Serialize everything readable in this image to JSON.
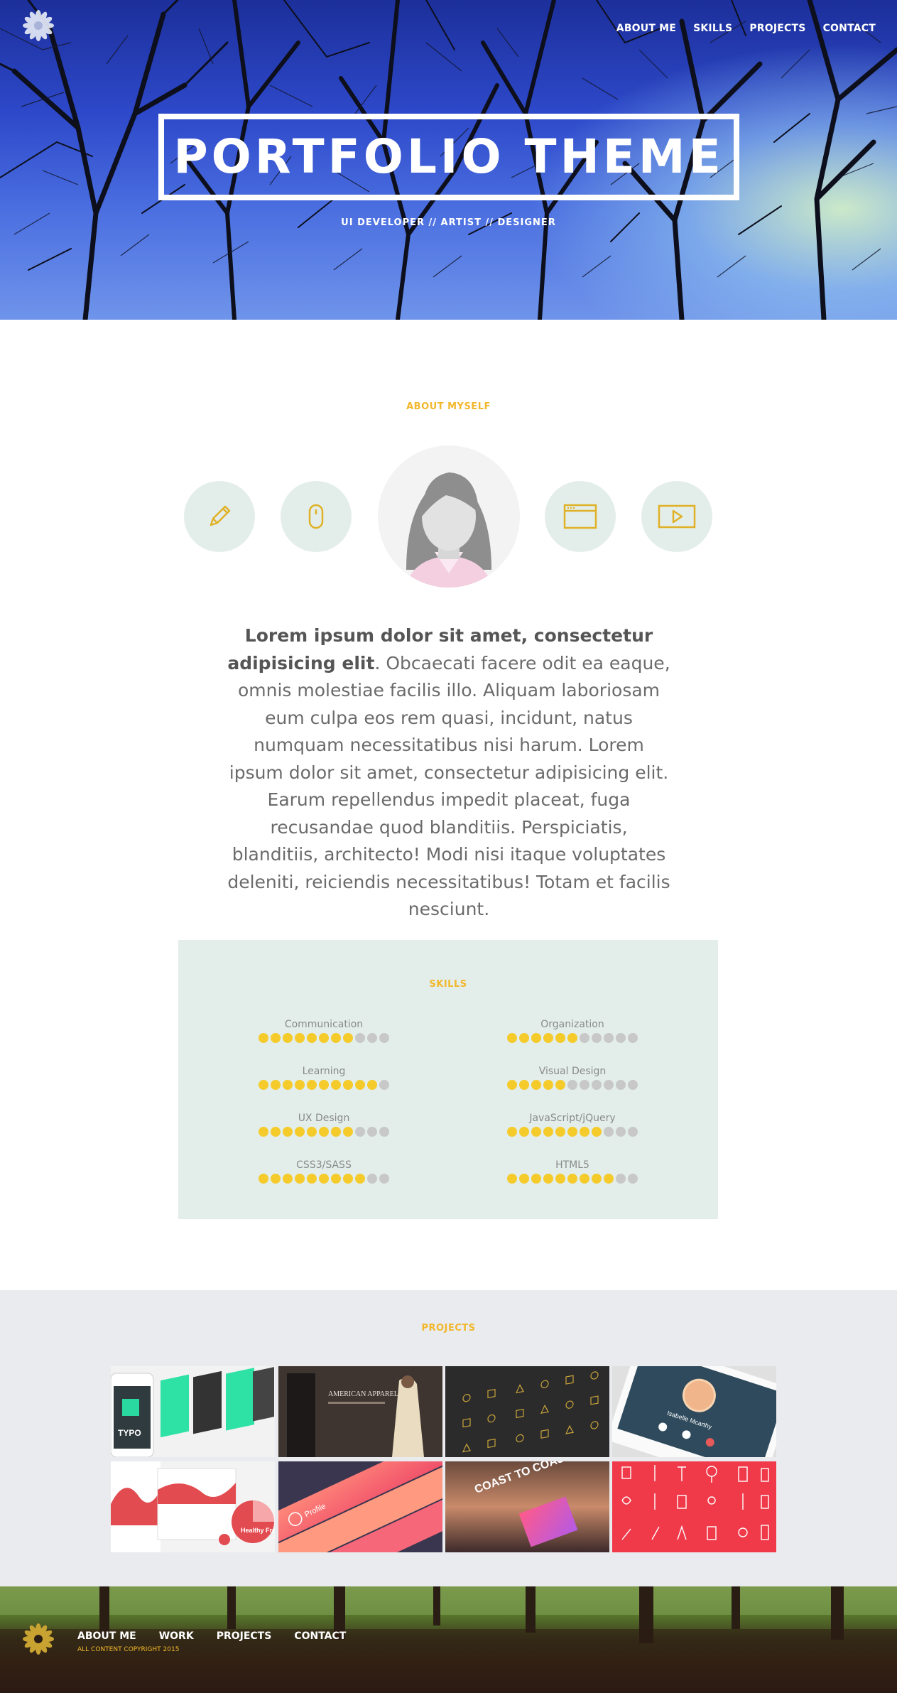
{
  "nav": {
    "items": [
      "ABOUT ME",
      "SKILLS",
      "PROJECTS",
      "CONTACT"
    ]
  },
  "hero": {
    "title": "PORTFOLIO THEME",
    "subtitle": "UI DEVELOPER // ARTIST // DESIGNER"
  },
  "about": {
    "label": "ABOUT MYSELF",
    "icons": [
      "pencil-icon",
      "mouse-icon",
      "browser-window-icon",
      "play-icon"
    ],
    "lead": "Lorem ipsum dolor sit amet, consectetur adipisicing elit",
    "body": ". Obcaecati facere odit ea eaque, omnis molestiae facilis illo. Aliquam laboriosam eum culpa eos rem quasi, incidunt, natus numquam necessitatibus nisi harum. Lorem ipsum dolor sit amet, consectetur adipisicing elit. Earum repellendus impedit placeat, fuga recusandae quod blanditiis. Perspiciatis, blanditiis, architecto! Modi nisi itaque voluptates deleniti, reiciendis necessitatibus! Totam et facilis nesciunt."
  },
  "skills": {
    "label": "SKILLS",
    "max": 11,
    "items": [
      {
        "name": "Communication",
        "level": 8
      },
      {
        "name": "Organization",
        "level": 6
      },
      {
        "name": "Learning",
        "level": 10
      },
      {
        "name": "Visual Design",
        "level": 5
      },
      {
        "name": "UX Design",
        "level": 8
      },
      {
        "name": "JavaScript/jQuery",
        "level": 8
      },
      {
        "name": "CSS3/SASS",
        "level": 9
      },
      {
        "name": "HTML5",
        "level": 9
      }
    ],
    "colors": {
      "on": "#f5cb2c",
      "off": "#c8c8c8"
    }
  },
  "projects": {
    "label": "PROJECTS",
    "items": [
      {
        "name": "typo-app-mockup",
        "caption": "TYPO"
      },
      {
        "name": "american-apparel-site",
        "caption": "AMERICAN APPAREL"
      },
      {
        "name": "gold-icon-pattern",
        "caption": ""
      },
      {
        "name": "profile-app-ui",
        "caption": "Isabelle Mcarthy"
      },
      {
        "name": "healthy-fruits-dashboard",
        "caption": "Healthy Fruits"
      },
      {
        "name": "profile-map-history",
        "caption": "Profile"
      },
      {
        "name": "coast-to-coast",
        "caption": "COAST TO COAST"
      },
      {
        "name": "red-tool-icons",
        "caption": ""
      }
    ]
  },
  "footer": {
    "nav": [
      "ABOUT ME",
      "WORK",
      "PROJECTS",
      "CONTACT"
    ],
    "copyright": "ALL CONTENT COPYRIGHT 2015"
  },
  "colors": {
    "accent": "#f2b72b",
    "mint": "#e3eeea",
    "projects_bg": "#e9ebee"
  }
}
